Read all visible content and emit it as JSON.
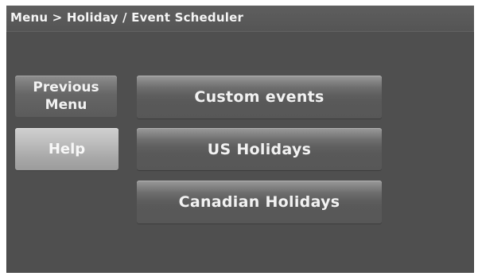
{
  "header": {
    "title": "Menu > Holiday / Event Scheduler"
  },
  "sidebar": {
    "previous_menu": {
      "line1": "Previous",
      "line2": "Menu"
    },
    "help_label": "Help"
  },
  "menu": {
    "items": [
      {
        "label": "Custom events"
      },
      {
        "label": "US Holidays"
      },
      {
        "label": "Canadian Holidays"
      }
    ]
  }
}
